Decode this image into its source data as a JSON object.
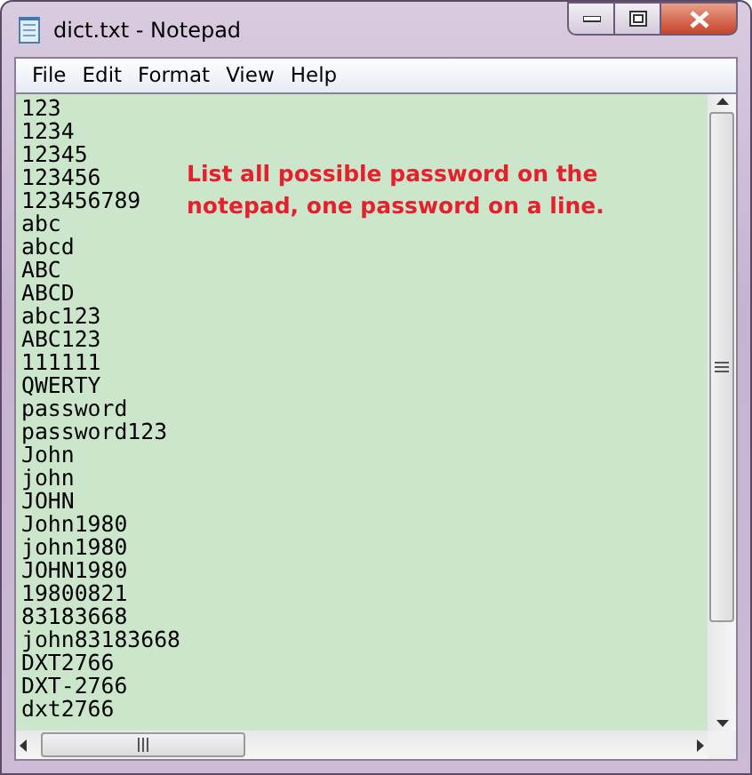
{
  "window": {
    "title": "dict.txt - Notepad"
  },
  "menu": [
    "File",
    "Edit",
    "Format",
    "View",
    "Help"
  ],
  "lines": [
    "123",
    "1234",
    "12345",
    "123456",
    "123456789",
    "abc",
    "abcd",
    "ABC",
    "ABCD",
    "abc123",
    "ABC123",
    "111111",
    "QWERTY",
    "password",
    "password123",
    "John",
    "john",
    "JOHN",
    "John1980",
    "john1980",
    "JOHN1980",
    "19800821",
    "83183668",
    "john83183668",
    "DXT2766",
    "DXT-2766",
    "dxt2766"
  ],
  "annotation": "List all possible password on the notepad, one password on a line."
}
